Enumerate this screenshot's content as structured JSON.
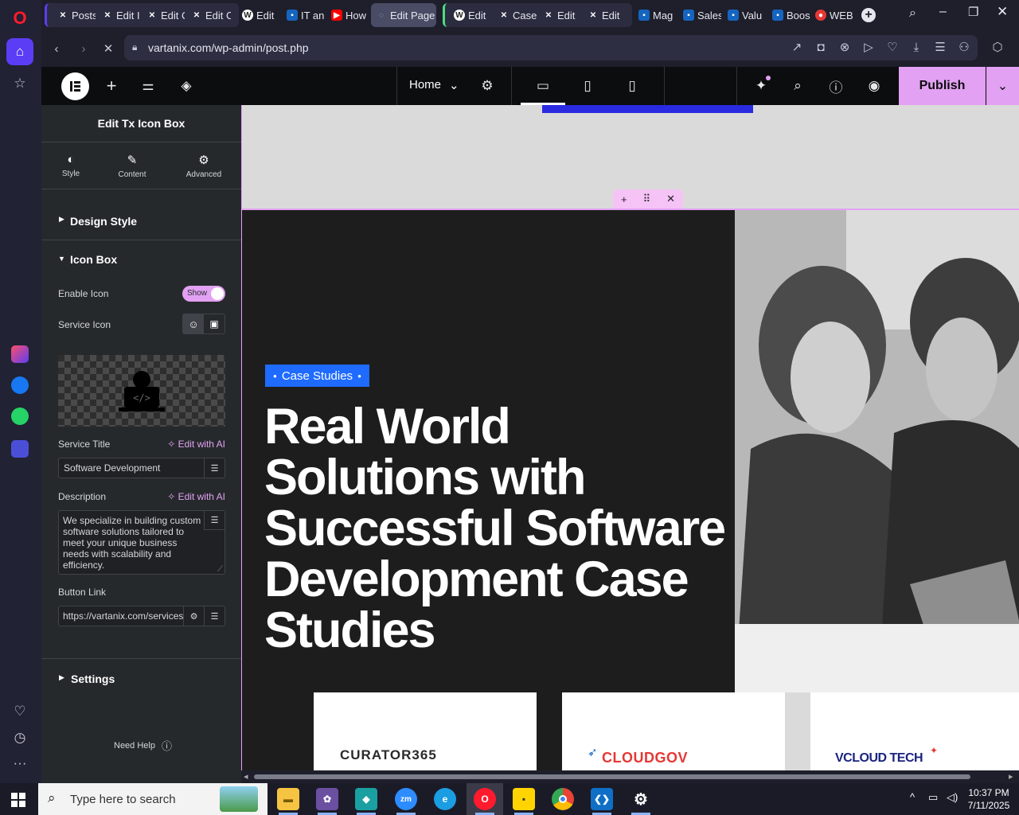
{
  "browser": {
    "tabs": [
      {
        "label": "Posts"
      },
      {
        "label": "Edit I"
      },
      {
        "label": "Edit C"
      },
      {
        "label": "Edit C"
      },
      {
        "label": "Edit"
      },
      {
        "label": "IT an"
      },
      {
        "label": "How"
      },
      {
        "label": "Edit Page"
      },
      {
        "label": "Edit"
      },
      {
        "label": "Case"
      },
      {
        "label": "Edit"
      },
      {
        "label": "Edit"
      },
      {
        "label": "Mag"
      },
      {
        "label": "Sales"
      },
      {
        "label": "Valu"
      },
      {
        "label": "Boos"
      },
      {
        "label": "WEB"
      }
    ],
    "url": "vartanix.com/wp-admin/post.php"
  },
  "elementor_top": {
    "page_selector": "Home",
    "publish_label": "Publish"
  },
  "panel": {
    "title": "Edit Tx Icon Box",
    "tabs": [
      {
        "label": "Style"
      },
      {
        "label": "Content"
      },
      {
        "label": "Advanced"
      }
    ],
    "design_style": "Design Style",
    "icon_box": "Icon Box",
    "enable_icon_label": "Enable Icon",
    "toggle_text": "Show",
    "service_icon_label": "Service Icon",
    "service_title_label": "Service Title",
    "edit_with_ai": "Edit with AI",
    "service_title_value": "Software Development",
    "description_label": "Description",
    "description_value": "We specialize in building custom software solutions tailored to meet your unique business needs with scalability and efficiency.",
    "button_link_label": "Button Link",
    "button_link_value": "https://vartanix.com/services",
    "settings": "Settings",
    "need_help": "Need Help"
  },
  "canvas": {
    "badge": "Case Studies",
    "headline_lines": [
      "Real World",
      "Solutions with",
      "Successful Software",
      "Development Case",
      "Studies"
    ],
    "logos": [
      {
        "name": "CURATOR365"
      },
      {
        "name": "CLOUDGOV"
      },
      {
        "name": "VCLOUD TECH"
      }
    ]
  },
  "taskbar": {
    "search_placeholder": "Type here to search",
    "time": "10:37 PM",
    "date": "7/11/2025"
  },
  "colors": {
    "accent_pink": "#e2a1f3",
    "badge_blue": "#1f6bff",
    "hero_dark": "#1d1d1d"
  }
}
